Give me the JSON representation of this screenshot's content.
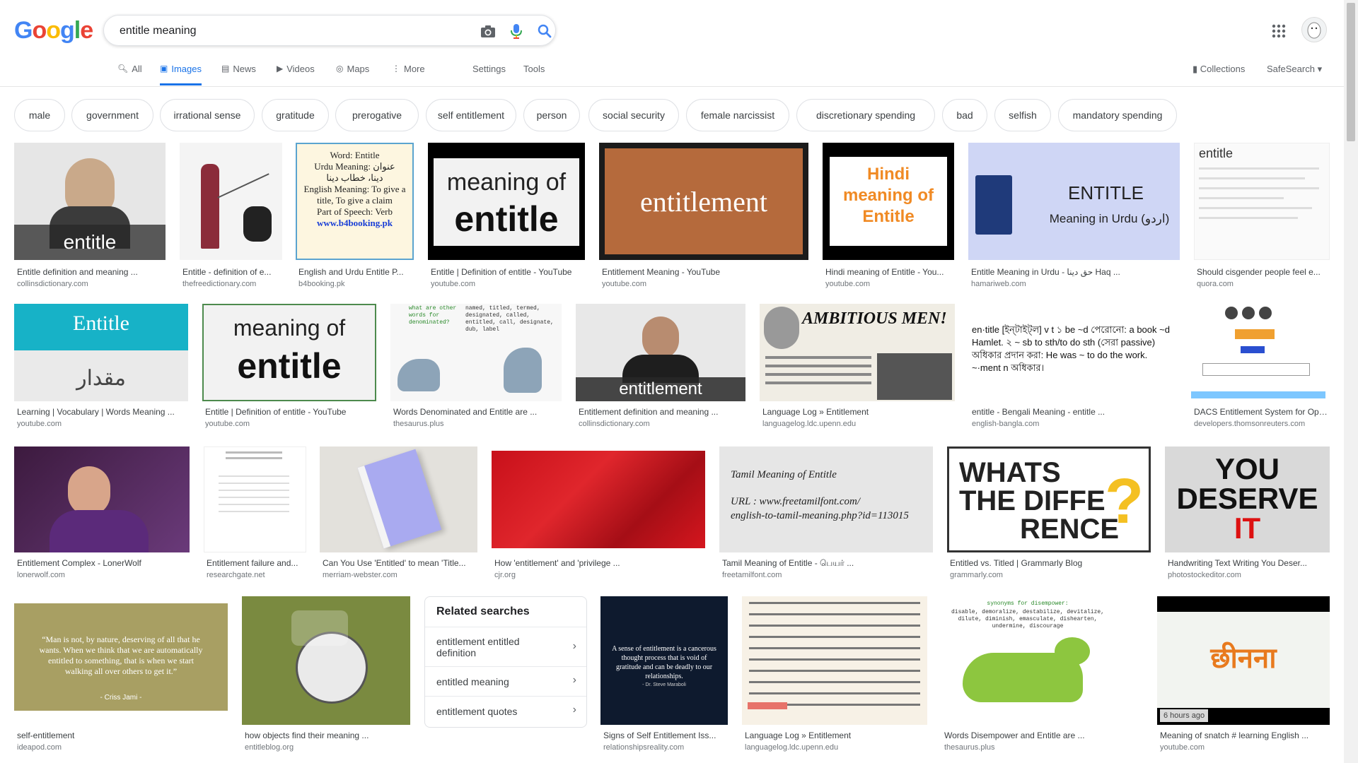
{
  "logo": {
    "G": "G",
    "o1": "o",
    "o2": "o",
    "g": "g",
    "l": "l",
    "e": "e"
  },
  "search": {
    "value": "entitle meaning"
  },
  "tabs": {
    "all": "All",
    "images": "Images",
    "news": "News",
    "videos": "Videos",
    "maps": "Maps",
    "more": "More",
    "settings": "Settings",
    "tools": "Tools"
  },
  "right": {
    "collections": "Collections",
    "safesearch": "SafeSearch"
  },
  "chips": [
    "male",
    "government",
    "irrational sense",
    "gratitude",
    "prerogative",
    "self entitlement",
    "person",
    "social security",
    "female narcissist",
    "discretionary spending",
    "bad",
    "selfish",
    "mandatory spending"
  ],
  "results": [
    {
      "caption": "Entitle definition and meaning ...",
      "source": "collinsdictionary.com",
      "overlay": "entitle"
    },
    {
      "caption": "Entitle - definition of e...",
      "source": "thefreedictionary.com"
    },
    {
      "caption": "English and Urdu Entitle P...",
      "source": "b4booking.pk",
      "line1": "Word: Entitle",
      "line2": "Urdu Meaning: عنوان",
      "line3": "دینا، خطاب دینا",
      "line4": "English Meaning: To give a title, To give a claim",
      "line5": "Part of Speech: Verb",
      "line6": "www.b4booking.pk"
    },
    {
      "caption": "Entitle | Definition of entitle - YouTube",
      "source": "youtube.com",
      "line1": "meaning of",
      "line2": "entitle"
    },
    {
      "caption": "Entitlement Meaning - YouTube",
      "source": "youtube.com",
      "overlay": "entitlement"
    },
    {
      "caption": "Hindi meaning of Entitle - You...",
      "source": "youtube.com",
      "line1": "Hindi",
      "line2": "meaning of",
      "line3": "Entitle"
    },
    {
      "caption": "Entitle Meaning in Urdu - حق دینا Haq ...",
      "source": "hamariweb.com",
      "line1": "ENTITLE",
      "line2": "Meaning in Urdu (اردو)"
    },
    {
      "caption": "Should cisgender people feel e...",
      "source": "quora.com",
      "line1": "entitle"
    },
    {
      "caption": "Learning | Vocabulary | Words Meaning ...",
      "source": "youtube.com",
      "line1": "Entitle",
      "line2": "مقدار"
    },
    {
      "caption": "Entitle | Definition of entitle - YouTube",
      "source": "youtube.com",
      "line1": "meaning of",
      "line2": "entitle"
    },
    {
      "caption": "Words Denominated and Entitle are ...",
      "source": "thesaurus.plus",
      "line1": "what are other words for denominated?",
      "line2": "named, titled, termed, designated, called, entitled, call, designate, dub, label"
    },
    {
      "caption": "Entitlement definition and meaning ...",
      "source": "collinsdictionary.com",
      "overlay": "entitlement"
    },
    {
      "caption": "Language Log » Entitlement",
      "source": "languagelog.ldc.upenn.edu",
      "line1": "AMBITIOUS MEN!"
    },
    {
      "caption": "entitle - Bengali Meaning - entitle ...",
      "source": "english-bangla.com",
      "line1": "en·title [ইন্‌টাইট্‌ল] v t ১ be ~d পেরোনো: a book ~d Hamlet. ২ ~ sb to sth/to do sth (সেরা passive) অধিকার প্রদান করা: He was ~ to do the work. ~·ment n অধিকার।"
    },
    {
      "caption": "DACS Entitlement System for Ope...",
      "source": "developers.thomsonreuters.com"
    },
    {
      "caption": "Entitlement Complex - LonerWolf",
      "source": "lonerwolf.com"
    },
    {
      "caption": "Entitlement failure and...",
      "source": "researchgate.net"
    },
    {
      "caption": "Can You Use 'Entitled' to mean 'Title...",
      "source": "merriam-webster.com"
    },
    {
      "caption": "How 'entitlement' and 'privilege ...",
      "source": "cjr.org"
    },
    {
      "caption": "Tamil Meaning of Entitle - பெயர் ...",
      "source": "freetamilfont.com",
      "line1": "Tamil Meaning of Entitle",
      "line2": "URL : www.freetamilfont.com/",
      "line3": "english-to-tamil-meaning.php?id=113015"
    },
    {
      "caption": "Entitled vs. Titled | Grammarly Blog",
      "source": "grammarly.com",
      "line1": "WHATS",
      "line2": "THE DIFFE",
      "line3": "RENCE"
    },
    {
      "caption": "Handwriting Text Writing You Deser...",
      "source": "photostockeditor.com",
      "line1": "YOU",
      "line2": "DESERVE",
      "line3": "IT"
    },
    {
      "caption": "self-entitlement",
      "source": "ideapod.com",
      "line1": "“Man is not, by nature, deserving of all that he wants. When we think that we are automatically entitled to something, that is when we start walking all over others to get it.”",
      "line2": "- Criss Jami -"
    },
    {
      "caption": "how objects find their meaning ...",
      "source": "entitleblog.org"
    },
    {
      "caption": "Signs of Self Entitlement Iss...",
      "source": "relationshipsreality.com",
      "line1": "A sense of entitlement is a cancerous thought process that is void of gratitude and can be deadly to our relationships.",
      "line2": "- Dr. Steve Maraboli"
    },
    {
      "caption": "Language Log » Entitlement",
      "source": "languagelog.ldc.upenn.edu"
    },
    {
      "caption": "Words Disempower and Entitle are ...",
      "source": "thesaurus.plus",
      "line1": "synonyms for disempower:",
      "line2": "disable, demoralize, destabilize, devitalize, dilute, diminish, emasculate, dishearten, undermine, discourage"
    },
    {
      "caption": "Meaning of snatch # learning English ...",
      "source": "youtube.com",
      "line1": "छीनना",
      "badge": "6 hours ago"
    }
  ],
  "related": {
    "title": "Related searches",
    "items": [
      "entitlement entitled definition",
      "entitled meaning",
      "entitlement quotes"
    ]
  },
  "colors": {
    "blue": "#4285F4",
    "red": "#EA4335",
    "yellow": "#FBBC05",
    "green": "#34A853",
    "accent": "#1a73e8"
  }
}
